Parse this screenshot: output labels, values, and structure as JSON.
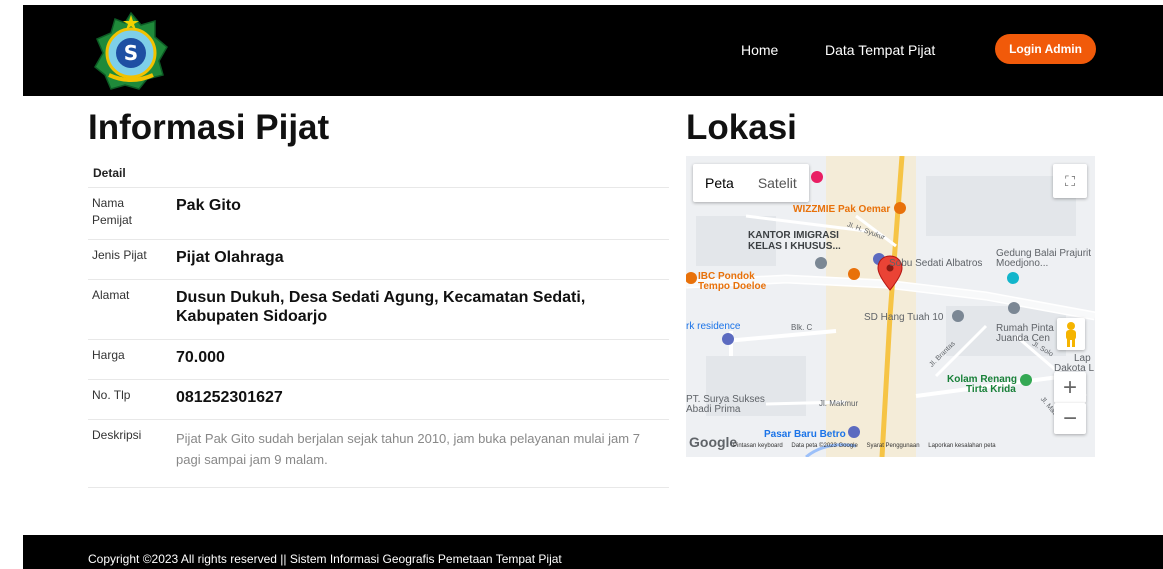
{
  "navbar": {
    "home_label": "Home",
    "data_label": "Data Tempat Pijat",
    "login_label": "Login Admin",
    "brand_color": "#f15a0a"
  },
  "info": {
    "title": "Informasi Pijat",
    "detail_header": "Detail",
    "rows": [
      {
        "label": "Nama Pemijat",
        "value": "Pak Gito"
      },
      {
        "label": "Jenis Pijat",
        "value": "Pijat Olahraga"
      },
      {
        "label": "Alamat",
        "value": "Dusun Dukuh, Desa Sedati Agung, Kecamatan Sedati, Kabupaten Sidoarjo"
      },
      {
        "label": "Harga",
        "value": "70.000"
      },
      {
        "label": "No. Tlp",
        "value": "081252301627"
      },
      {
        "label": "Deskripsi",
        "value": "Pijat Pak Gito sudah berjalan sejak tahun 2010, jam buka pelayanan mulai jam 7 pagi sampai jam 9 malam."
      }
    ]
  },
  "location": {
    "title": "Lokasi",
    "map_type_peta": "Peta",
    "map_type_satelit": "Satelit",
    "places": {
      "wizzmie": "WIZZMIE Pak Oemar",
      "kantor_1": "KANTOR IMIGRASI",
      "kantor_2": "KELAS I KHUSUS...",
      "gedung_1": "Gedung Balai Prajurit",
      "gedung_2": "Moedjono...",
      "sobu": "Sobu Sedati Albatros",
      "ibc_1": "IBC Pondok",
      "ibc_2": "Tempo Doeloe",
      "residence": "rk residence",
      "blk": "Blk. C",
      "sd": "SD Hang Tuah 10",
      "rumah_1": "Rumah Pinta",
      "rumah_2": "Juanda Cen",
      "lapdakota_1": "Lap",
      "lapdakota_2": "Dakota L",
      "kolam_1": "Kolam Renang",
      "kolam_2": "Tirta Krida",
      "surya_1": "PT. Surya Sukses",
      "surya_2": "Abadi Prima",
      "pasar": "Pasar Baru Betro",
      "jl_makmur": "Jl. Makmur",
      "jl_syukur": "Jl. H. Syukur",
      "jl_solo": "Jl. Solo",
      "jl_brantas": "Jl. Brantas",
      "jl_mawar": "Jl. Mawar"
    },
    "google_logo": "Google",
    "attribution": {
      "keyboard": "Pintasan keyboard",
      "data": "Data peta ©2023 Google",
      "terms": "Syarat Penggunaan",
      "report": "Laporkan kesalahan peta"
    }
  },
  "footer": {
    "text": "Copyright ©2023 All rights reserved || Sistem Informasi Geografis Pemetaan Tempat Pijat"
  }
}
